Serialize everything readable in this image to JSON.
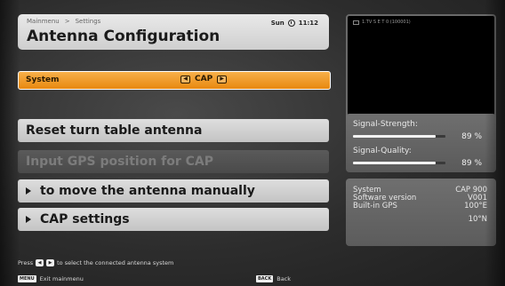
{
  "header": {
    "breadcrumb": [
      "Mainmenu",
      "Settings"
    ],
    "breadcrumb_sep": ">",
    "title": "Antenna Configuration",
    "day": "Sun",
    "time": "11:12"
  },
  "system": {
    "label": "System",
    "value": "CAP",
    "left_arrow": "◀",
    "right_arrow": "▶"
  },
  "menu": [
    {
      "label": "Reset turn table antenna",
      "enabled": true,
      "submenu": false
    },
    {
      "label": "Input GPS position for CAP",
      "enabled": false,
      "submenu": false
    },
    {
      "label": "to move the antenna manually",
      "enabled": true,
      "submenu": true
    },
    {
      "label": "CAP settings",
      "enabled": true,
      "submenu": true
    }
  ],
  "hint": {
    "prefix": "Press",
    "text": "to select the connected antenna system"
  },
  "footer": {
    "menu_key": "MENU",
    "menu_label": "Exit mainmenu",
    "back_key": "BACK",
    "back_label": "Back"
  },
  "preview": {
    "channel_label": "1.TV S E T 0 (100001)",
    "icon": "tv-icon"
  },
  "signal": {
    "strength_label": "Signal-Strength:",
    "strength_value": "89 %",
    "strength_percent": 89,
    "quality_label": "Signal-Quality:",
    "quality_value": "89 %",
    "quality_percent": 89
  },
  "info": {
    "labels": [
      "System",
      "Software version",
      "Built-in GPS"
    ],
    "values": [
      "CAP 900",
      "V001",
      "100°E",
      "10°N"
    ]
  },
  "colors": {
    "accent": "#e8880f",
    "menu_bg": "#d4d4d4",
    "panel_bg": "#646464"
  }
}
